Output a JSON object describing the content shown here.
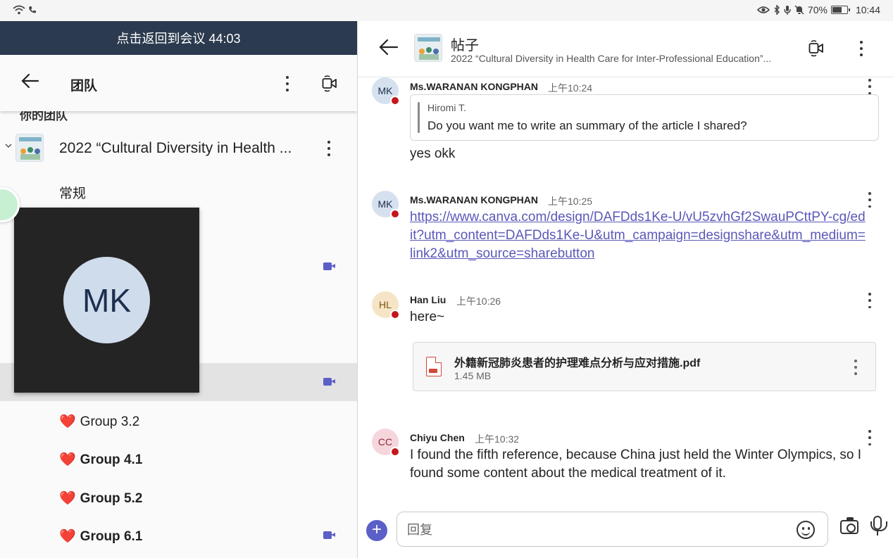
{
  "status_bar": {
    "battery": "70%",
    "battery_level": 0.7,
    "time": "10:44"
  },
  "left_panel": {
    "meeting_banner": "点击返回到会议 44:03",
    "header_title": "团队",
    "partial_heading": "你的团队",
    "team_name": "2022 “Cultural Diversity in Health ...",
    "channels": [
      {
        "label": "常规"
      },
      {
        "label": "Group 3.2",
        "heart": "❤️"
      },
      {
        "label": "Group 4.1",
        "heart": "❤️"
      },
      {
        "label": "Group 5.2",
        "heart": "❤️"
      },
      {
        "label": "Group 6.1",
        "heart": "❤️"
      }
    ],
    "video_tile": {
      "initials": "MK"
    }
  },
  "right_panel": {
    "header": {
      "title": "帖子",
      "subtitle": "2022 “Cultural Diversity in Health Care for Inter-Professional Education”..."
    },
    "messages": [
      {
        "initials": "MK",
        "sender": "Ms.WARANAN KONGPHAN",
        "time": "上午10:24",
        "quote_author": "Hiromi T.",
        "quote_text": "Do you want me to write an summary of the article I shared?",
        "text": "yes okk"
      },
      {
        "initials": "MK",
        "sender": "Ms.WARANAN KONGPHAN",
        "time": "上午10:25",
        "link": "https://www.canva.com/design/DAFDds1Ke-U/vU5zvhGf2SwauPCttPY-cg/edit?utm_content=DAFDds1Ke-U&utm_campaign=designshare&utm_medium=link2&utm_source=sharebutton"
      },
      {
        "initials": "HL",
        "sender": "Han Liu",
        "time": "上午10:26",
        "text": "here~",
        "file_name": "外籍新冠肺炎患者的护理难点分析与应对措施.pdf",
        "file_size": "1.45 MB"
      },
      {
        "initials": "CC",
        "sender": "Chiyu Chen",
        "time": "上午10:32",
        "text": "I found the fifth reference, because China just held the Winter Olympics, so I found some content about the medical treatment of it."
      }
    ],
    "composer": {
      "placeholder": "回复"
    }
  },
  "colors": {
    "meeting_bar": "#2b3a4e",
    "accent": "#5b5fc7",
    "presence_busy": "#c4161c",
    "link": "#5a58b8"
  },
  "icons": [
    "wifi-icon",
    "phone-icon",
    "eye-icon",
    "bluetooth-icon",
    "mic-status-icon",
    "bell-off-icon",
    "battery-icon",
    "back-arrow-icon",
    "more-icon",
    "video-call-icon",
    "chevron-down-icon",
    "pdf-icon",
    "add-icon",
    "emoji-icon",
    "camera-icon",
    "microphone-icon"
  ]
}
